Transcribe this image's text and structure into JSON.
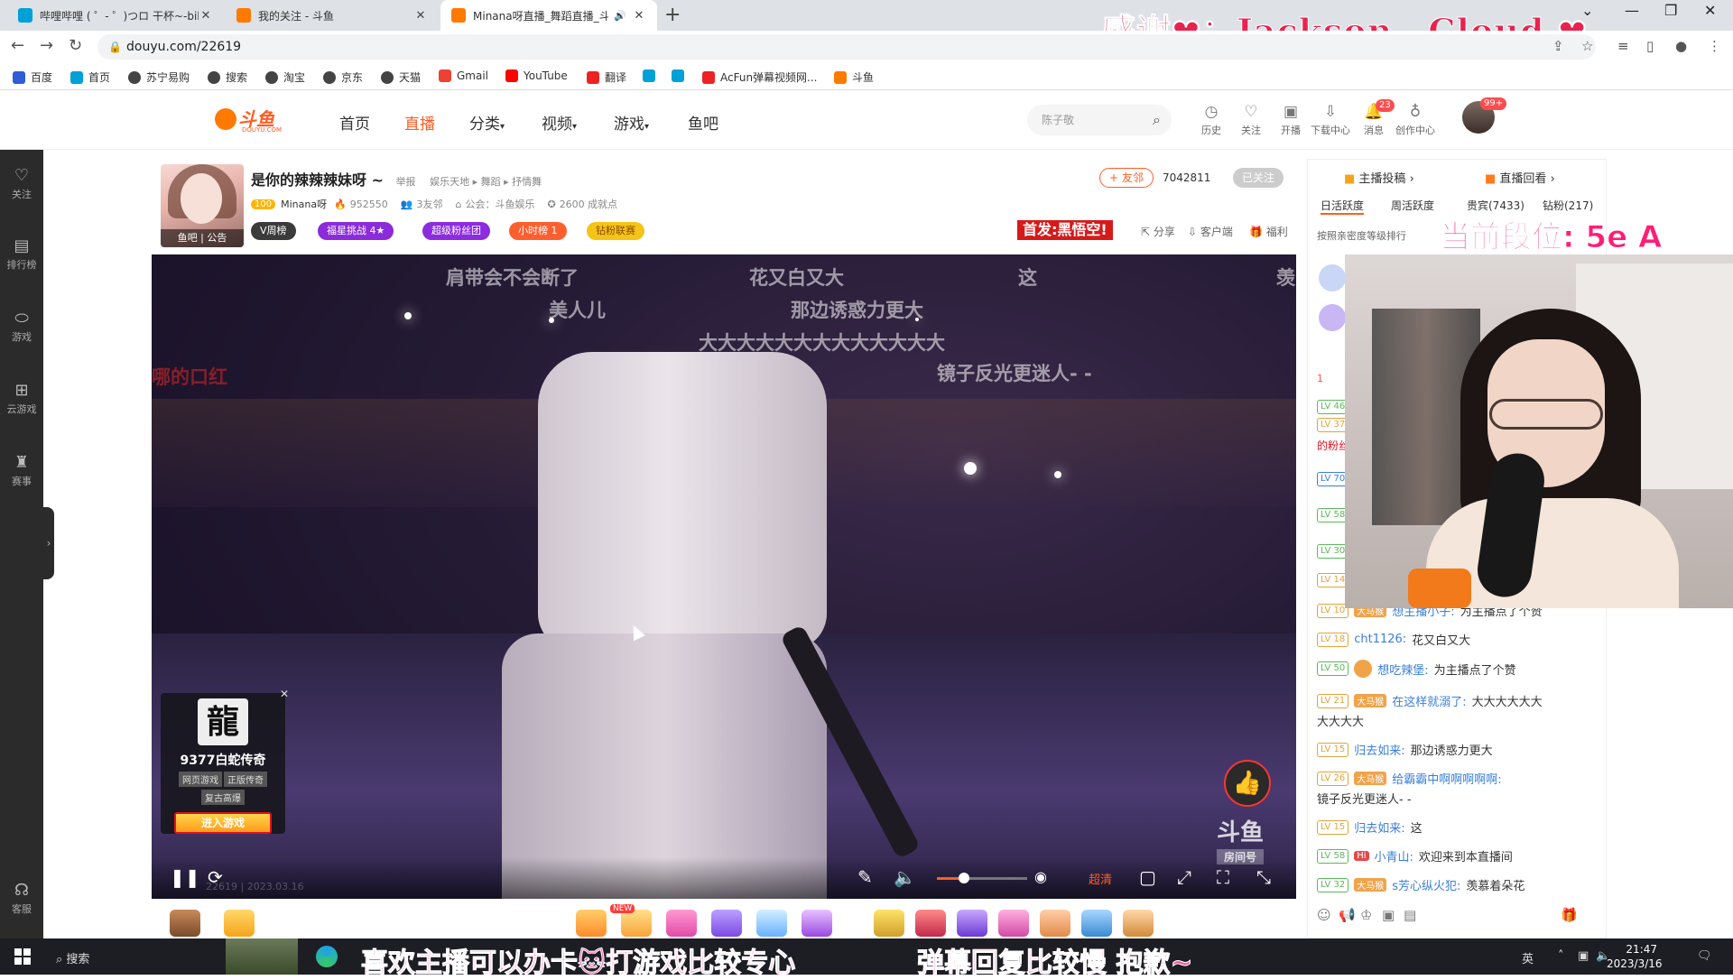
{
  "tabs": [
    {
      "title": "哔哩哔哩 ( ゜- ゜)つロ 干杯~-bili",
      "favicon_color": "#00a1d6"
    },
    {
      "title": "我的关注 - 斗鱼",
      "favicon_color": "#ff7a00"
    },
    {
      "title": "Minana呀直播_舞蹈直播_斗",
      "favicon_color": "#ff7a00",
      "active": true
    }
  ],
  "overlay_thanks": "感谢❤：Jackson灬Cloud ❤",
  "address": "douyu.com/22619",
  "bookmarks": [
    "百度",
    "首页",
    "苏宁易购",
    "搜索",
    "淘宝",
    "京东",
    "天猫",
    "Gmail",
    "YouTube",
    "翻译",
    "",
    "",
    "AcFun弹幕视频网...",
    "斗鱼"
  ],
  "header": {
    "logo": "斗鱼",
    "logo_sub": "DOUYU.COM",
    "nav": [
      "首页",
      "直播",
      "分类",
      "视频",
      "游戏",
      "鱼吧"
    ],
    "search_placeholder": "陈子敬",
    "icons": [
      {
        "label": "历史",
        "icon": "clock-icon"
      },
      {
        "label": "关注",
        "icon": "heart-icon"
      },
      {
        "label": "开播",
        "icon": "camera-icon"
      },
      {
        "label": "下载中心",
        "icon": "download-icon"
      },
      {
        "label": "消息",
        "icon": "bell-icon",
        "badge": "23"
      },
      {
        "label": "创作中心",
        "icon": "bulb-icon"
      }
    ],
    "avatar_badge": "99+"
  },
  "sidebar": [
    {
      "label": "关注",
      "icon": "heart-icon"
    },
    {
      "label": "排行榜",
      "icon": "rank-icon"
    },
    {
      "label": "游戏",
      "icon": "mouse-icon"
    },
    {
      "label": "云游戏",
      "icon": "gamepad-icon"
    },
    {
      "label": "赛事",
      "icon": "trophy-icon"
    },
    {
      "label": "客服",
      "icon": "headset-icon"
    }
  ],
  "anchor": {
    "title": "是你的辣辣辣妹呀 ~",
    "report": "举报",
    "category": "娱乐天地 ▸ 舞蹈 ▸ 抒情舞",
    "level": "100",
    "name": "Minana呀",
    "hot": "952550",
    "friends": "3友邻",
    "guild": "公会：斗鱼娱乐",
    "achievements": "2600 成就点",
    "avatar_tabs": "鱼吧 | 公告",
    "pills": [
      {
        "label": "V周榜",
        "color": "#3b3b3b"
      },
      {
        "label": "福星挑战  4★",
        "color": "#8b2bd9"
      },
      {
        "label": "超级粉丝团",
        "color": "#8c2be0"
      },
      {
        "label": "小时榜  1",
        "color": "#ff5f2e"
      },
      {
        "label": "钻粉联赛",
        "color": "#f5c418"
      }
    ],
    "follow_label": "+ 友邻",
    "fans": "7042811",
    "followed": "已关注",
    "first_launch": "首发:黑悟空!",
    "actions": [
      "分享",
      "客户端",
      "福利"
    ]
  },
  "video": {
    "danmu": [
      "肩带会不会断了",
      "花又白又大",
      "美人儿",
      "那边诱惑力更大",
      "大大大大大大大大大大大大大",
      "镜子反光更迷人- -",
      "这",
      "羡",
      "哪的口红"
    ],
    "ad": {
      "game": "9377白蛇传奇",
      "tags": [
        "网页游戏",
        "正版传奇",
        "复古高爆"
      ],
      "enter": "进入游戏",
      "icon_char": "龍"
    },
    "watermark": "斗鱼",
    "room_label": "房间号",
    "room_number": "22619",
    "info": "22619 | 2023.03.16",
    "quality": "超清",
    "volume": 0.3
  },
  "right": {
    "top_tabs": [
      "主播投稿",
      "直播回看"
    ],
    "ranks": [
      "日活跃度",
      "周活跃度",
      "贵宾(7433)",
      "钻粉(217)"
    ],
    "rank_note": "按照亲密度等级排行",
    "segment": "当前段位: 5e A",
    "left_levels": [
      {
        "lv": "LV 46",
        "color": "#5cb85c"
      },
      {
        "lv": "LV 37",
        "color": "#e0a43a"
      },
      {
        "lv": "LV 70",
        "color": "#3a7fd8"
      },
      {
        "lv": "LV 58",
        "color": "#5cb85c"
      },
      {
        "lv": "LV 30",
        "color": "#5cb85c"
      },
      {
        "lv": "LV 14",
        "color": "#e0a43a"
      }
    ],
    "fragment_1": "1",
    "fragment_2": "的粉丝",
    "chat": [
      {
        "lv": "LV 10",
        "color": "#e0a43a",
        "user": "想主播小子:",
        "text": "为主播点了个赞",
        "badge": "大马猴"
      },
      {
        "lv": "LV 18",
        "color": "#e0a43a",
        "user": "cht1126:",
        "text": "花又白又大",
        "badge": ""
      },
      {
        "lv": "LV 50",
        "color": "#5cb85c",
        "user": "想吃辣堡:",
        "text": "为主播点了个赞",
        "badge": ""
      },
      {
        "lv": "LV 21",
        "color": "#e0a43a",
        "user": "在这样就溺了:",
        "text": "大大大大大大",
        "badge": "大马猴"
      },
      {
        "lv": "",
        "color": "",
        "user": "",
        "text": "大大大大",
        "badge": ""
      },
      {
        "lv": "LV 15",
        "color": "#e0a43a",
        "user": "归去如来:",
        "text": "那边诱惑力更大",
        "badge": ""
      },
      {
        "lv": "LV 26",
        "color": "#e0a43a",
        "user": "给霸霸中啊啊啊啊啊:",
        "text": "",
        "badge": "大马猴"
      },
      {
        "lv": "",
        "color": "",
        "user": "",
        "text": "镜子反光更迷人- -",
        "badge": ""
      },
      {
        "lv": "LV 15",
        "color": "#e0a43a",
        "user": "归去如来:",
        "text": "这",
        "badge": ""
      },
      {
        "lv": "LV 58",
        "color": "#5cb85c",
        "user": "小青山:",
        "text": "欢迎来到本直播间",
        "badge": "Hi"
      },
      {
        "lv": "LV 32",
        "color": "#5cb85c",
        "user": "s芳心纵火犯:",
        "text": "羡慕着朵花",
        "badge": "大马猴"
      }
    ]
  },
  "taskbar": {
    "search": "搜索",
    "subtitle_left": "喜欢主播可以办卡🐱打游戏比较专心",
    "subtitle_right": "弹幕回复比较慢 抱歉~",
    "time": "21:47",
    "date": "2023/3/16",
    "ime": "英"
  }
}
